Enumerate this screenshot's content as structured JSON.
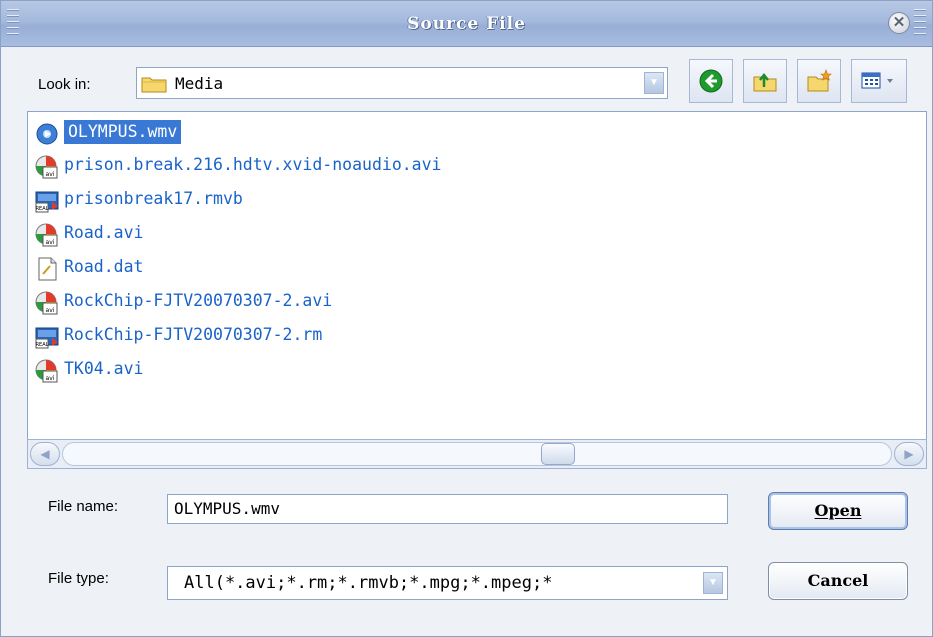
{
  "window": {
    "title": "Source File"
  },
  "lookin": {
    "label": "Look in:",
    "value": "Media"
  },
  "toolbar": [
    "back-icon",
    "up-folder-icon",
    "new-folder-icon",
    "view-menu-icon"
  ],
  "files": [
    {
      "name": "OLYMPUS.wmv",
      "icon": "wmv-icon",
      "selected": true
    },
    {
      "name": "prison.break.216.hdtv.xvid-noaudio.avi",
      "icon": "avi-icon",
      "selected": false
    },
    {
      "name": "prisonbreak17.rmvb",
      "icon": "real-media-icon",
      "selected": false
    },
    {
      "name": "Road.avi",
      "icon": "avi-icon",
      "selected": false
    },
    {
      "name": "Road.dat",
      "icon": "dat-file-icon",
      "selected": false
    },
    {
      "name": "RockChip-FJTV20070307-2.avi",
      "icon": "avi-icon",
      "selected": false
    },
    {
      "name": "RockChip-FJTV20070307-2.rm",
      "icon": "real-media-icon",
      "selected": false
    },
    {
      "name": "TK04.avi",
      "icon": "avi-icon",
      "selected": false
    }
  ],
  "filename": {
    "label": "File name:",
    "value": "OLYMPUS.wmv"
  },
  "filetype": {
    "label": "File type:",
    "value": "All(*.avi;*.rm;*.rmvb;*.mpg;*.mpeg;*"
  },
  "buttons": {
    "open": "Open",
    "cancel": "Cancel"
  },
  "scroll": {
    "position": 0.6
  }
}
